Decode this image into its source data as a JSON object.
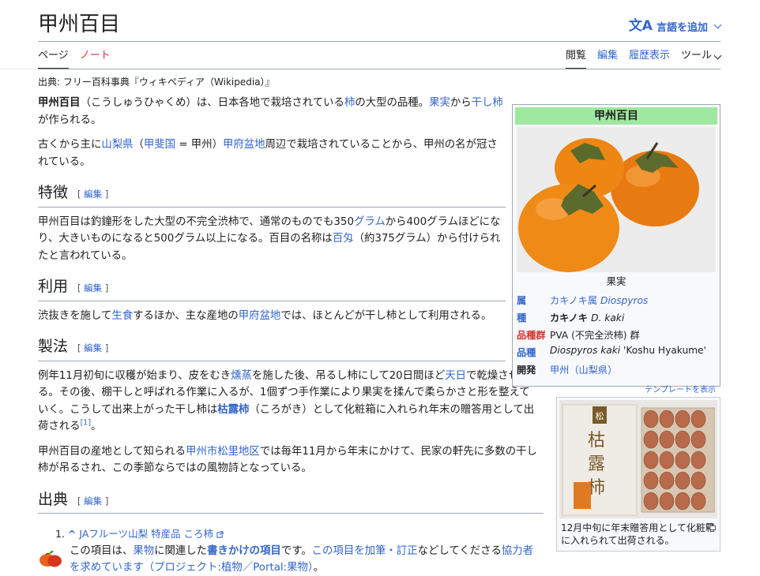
{
  "title": "甲州百目",
  "lang_button": "言語を追加",
  "tabs_left": [
    "ページ",
    "ノート"
  ],
  "tabs_right": [
    "閲覧",
    "編集",
    "履歴表示",
    "ツール"
  ],
  "site_sub": "出典: フリー百科事典『ウィキペディア（Wikipedia）』",
  "edit_label": "編集",
  "lead": {
    "p1": {
      "bold": "甲州百目",
      "t1": "（こうしゅうひゃくめ）は、日本各地で栽培されている",
      "l1": "柿",
      "t2": "の大型の品種。",
      "l2": "果実",
      "t3": "から",
      "l3": "干し柿",
      "t4": "が作られる。"
    },
    "p2": {
      "t1": "古くから主に",
      "l1": "山梨県",
      "t2": "（",
      "l2": "甲斐国",
      "t3": " = 甲州）",
      "l3": "甲府盆地",
      "t4": "周辺で栽培されていることから、甲州の名が冠されている。"
    }
  },
  "sections": {
    "tokucho": {
      "heading": "特徴",
      "p": {
        "t1": "甲州百目は釣鐘形をした大型の不完全渋柿で、通常のものでも350",
        "l1": "グラム",
        "t2": "から400グラムほどになり、大きいものになると500グラム以上になる。百目の名称は",
        "l2": "百匁",
        "t3": "（約375グラム）から付けられたと言われている。"
      }
    },
    "riyo": {
      "heading": "利用",
      "p": {
        "t1": "渋抜きを施して",
        "l1": "生食",
        "t2": "するほか、主な産地の",
        "l2": "甲府盆地",
        "t3": "では、ほとんどが干し柿として利用される。"
      }
    },
    "seiho": {
      "heading": "製法",
      "p1": {
        "t1": "例年11月初旬に収穫が始まり、皮をむき",
        "l1": "燻蒸",
        "t2": "を施した後、吊るし柿にして20日間ほど",
        "l2": "天日",
        "t3": "で乾燥させる。その後、棚干しと呼ばれる作業に入るが、1個ずつ手作業により果実を揉んで柔らかさと形を整えていく。こうして出来上がった干し柿は",
        "l3": "枯露柿",
        "t4": "（ころがき）として化粧箱に入れられ年末の贈答用として出荷される",
        "ref": "[1]",
        "t5": "。"
      },
      "p2": {
        "t1": "甲州百目の産地として知られる",
        "l1": "甲州市松里地区",
        "t2": "では毎年11月から年末にかけて、民家の軒先に多数の干し柿が吊るされ、この季節ならではの風物詩となっている。"
      }
    },
    "shutten": {
      "heading": "出典",
      "ref_caret": "^",
      "ref_link": "JAフルーツ山梨 特産品 ころ柿"
    }
  },
  "stub": {
    "t1": "この項目は、",
    "l1": "果物",
    "t2": "に関連した",
    "b1": "書きかけの項目",
    "t3": "です。",
    "l2": "この項目を加筆・訂正",
    "t4": "などしてくださる",
    "l3": "協力者を求めています",
    "l4": "（プロジェクト:植物／Portal:果物）",
    "t5": "。"
  },
  "infobox": {
    "title": "甲州百目",
    "caption": "果実",
    "rows": [
      {
        "key": "属",
        "key_color": "link",
        "value": "カキノキ属 ",
        "value_italic": "Diospyros",
        "value_color": "link"
      },
      {
        "key": "種",
        "key_color": "link",
        "value": "カキノキ ",
        "value_italic": "D. kaki",
        "value_bold": true,
        "value_color": "text"
      },
      {
        "key": "品種群",
        "key_color": "red",
        "value": "PVA (不完全渋柿) 群",
        "value_italic": "",
        "value_color": "text"
      },
      {
        "key": "品種",
        "key_color": "link",
        "value": "",
        "value_italic": "Diospyros kaki",
        "value_after": " 'Koshu Hyakume'",
        "value_color": "text"
      },
      {
        "key": "開発",
        "key_color": "text",
        "value": "甲州（山梨県）",
        "value_italic": "",
        "value_color": "link"
      }
    ],
    "footer": "テンプレートを表示"
  },
  "thumb": {
    "caption": "12月中旬に年末贈答用として化粧箱に入れられて出荷される。",
    "box_label": "枯露柿",
    "box_seal": "松"
  },
  "colors": {
    "link": "#3366cc",
    "red_link": "#d73333",
    "infobox_header": "#9fe89f",
    "persimmon": "#f08a1c"
  }
}
